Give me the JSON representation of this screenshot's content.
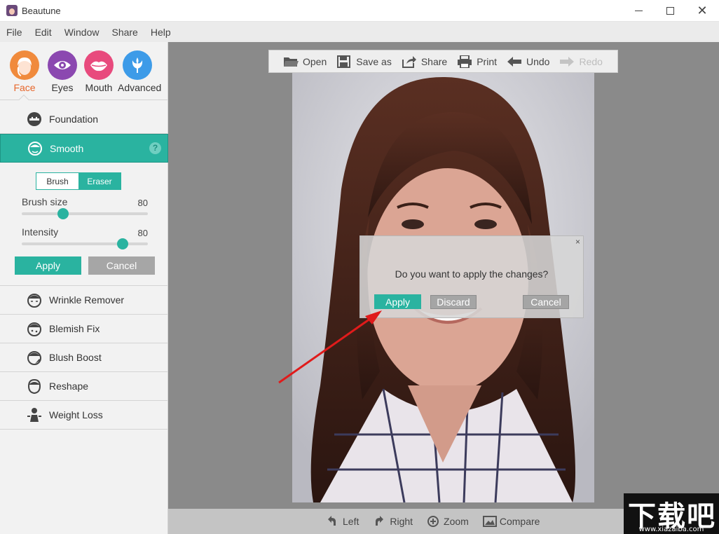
{
  "window": {
    "title": "Beautune"
  },
  "menu": [
    "File",
    "Edit",
    "Window",
    "Share",
    "Help"
  ],
  "categories": [
    {
      "label": "Face",
      "icon": "face-icon",
      "active": true,
      "color": "#f08a3c"
    },
    {
      "label": "Eyes",
      "icon": "eye-icon",
      "active": false,
      "color": "#8b48b0"
    },
    {
      "label": "Mouth",
      "icon": "lips-icon",
      "active": false,
      "color": "#e84a7d"
    },
    {
      "label": "Advanced",
      "icon": "flower-icon",
      "active": false,
      "color": "#3d9be8"
    }
  ],
  "tools": {
    "foundation": "Foundation",
    "smooth": "Smooth",
    "help_mark": "?",
    "wrinkle_remover": "Wrinkle Remover",
    "blemish_fix": "Blemish Fix",
    "blush_boost": "Blush Boost",
    "reshape": "Reshape",
    "weight_loss": "Weight Loss"
  },
  "smooth_settings": {
    "mode_brush": "Brush",
    "mode_eraser": "Eraser",
    "brush_size_label": "Brush size",
    "brush_size_value": "80",
    "brush_size_level": 0.33,
    "intensity_label": "Intensity",
    "intensity_value": "80",
    "intensity_level": 0.8,
    "apply": "Apply",
    "cancel": "Cancel"
  },
  "toolbar": {
    "open": "Open",
    "save_as": "Save as",
    "share": "Share",
    "print": "Print",
    "undo": "Undo",
    "redo": "Redo"
  },
  "dialog": {
    "close": "×",
    "message": "Do you want to apply the changes?",
    "apply": "Apply",
    "discard": "Discard",
    "cancel": "Cancel"
  },
  "bottombar": {
    "left": "Left",
    "right": "Right",
    "zoom": "Zoom",
    "compare": "Compare"
  },
  "watermark": {
    "big": "下载吧",
    "small": "www.xiazaiba.com"
  },
  "colors": {
    "accent": "#2ab3a0",
    "face": "#f08a3c",
    "arrow": "#e01b1b"
  }
}
